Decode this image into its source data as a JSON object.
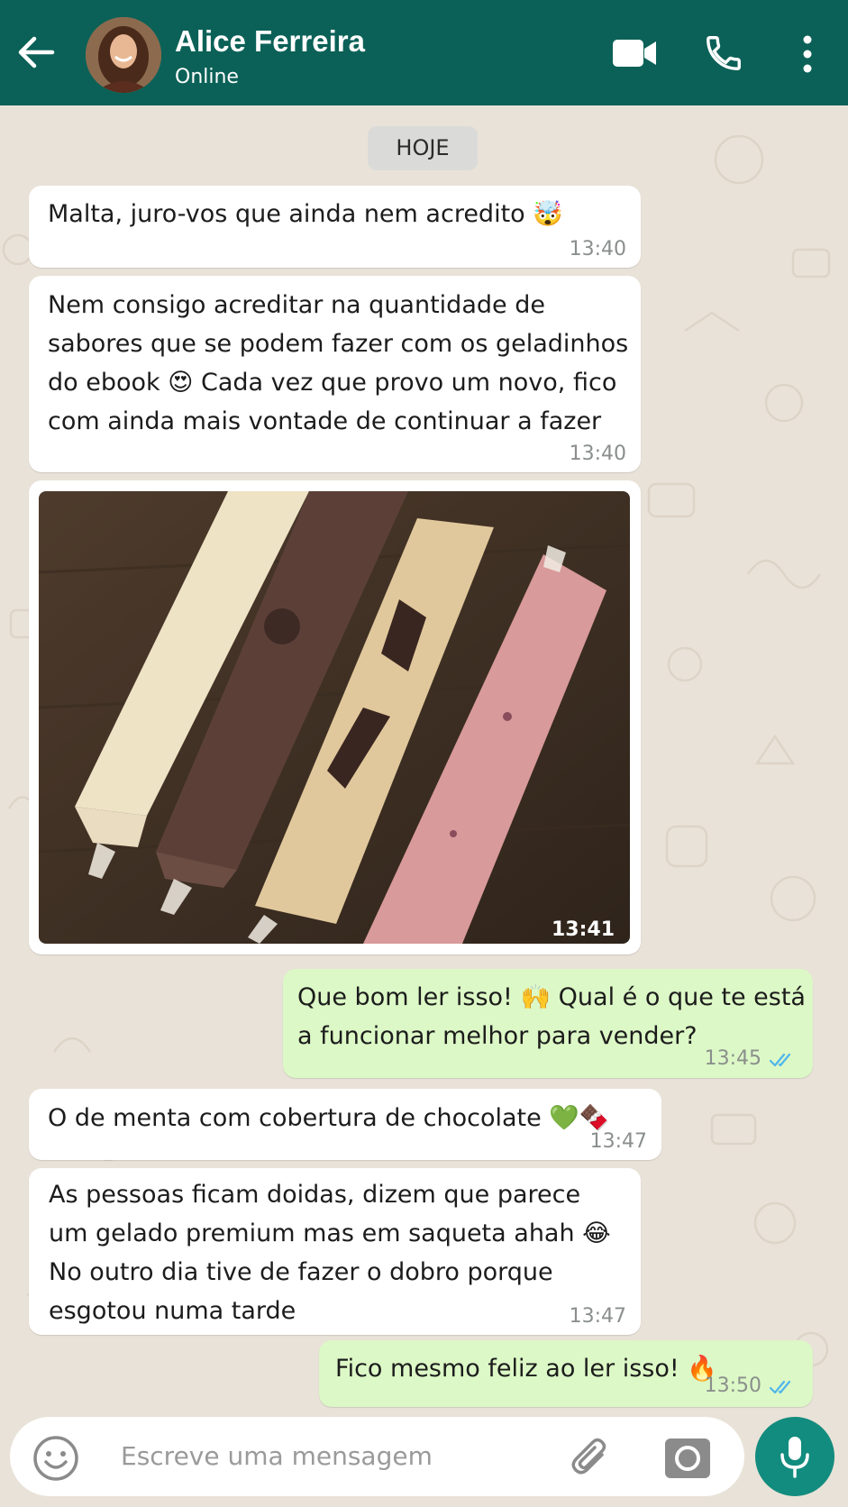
{
  "header": {
    "contact_name": "Alice Ferreira",
    "status": "Online",
    "icons": [
      "back-arrow-icon",
      "video-call-icon",
      "phone-icon",
      "more-options-icon"
    ]
  },
  "chat": {
    "day_label": "HOJE",
    "messages": [
      {
        "direction": "in",
        "lines": [
          "Malta, juro-vos que ainda nem acredito 🤯"
        ],
        "time": "13:40"
      },
      {
        "direction": "in",
        "lines": [
          "Nem consigo acreditar na quantidade de",
          "sabores que se podem fazer com os geladinhos",
          "do ebook 😍 Cada vez que provo um novo, fico",
          "com ainda mais vontade de continuar a fazer"
        ],
        "time": "13:40"
      },
      {
        "direction": "in",
        "image": "four frozen geladinho ice pops in plastic bags on a wooden board",
        "time": "13:41"
      },
      {
        "direction": "out",
        "lines": [
          "Que bom ler isso! 🙌 Qual é o que te está",
          "a funcionar melhor para vender?"
        ],
        "time": "13:45",
        "read": true
      },
      {
        "direction": "in",
        "lines": [
          "O de menta com cobertura de chocolate 💚🍫"
        ],
        "time": "13:47"
      },
      {
        "direction": "in",
        "lines": [
          "As pessoas ficam doidas, dizem que parece",
          "um gelado premium mas em saqueta ahah 😂",
          "No outro dia tive de fazer o dobro porque",
          "esgotou numa tarde"
        ],
        "time": "13:47"
      },
      {
        "direction": "out",
        "lines": [
          "Fico mesmo feliz ao ler isso! 🔥"
        ],
        "time": "13:50",
        "read": true
      }
    ]
  },
  "composer": {
    "placeholder": "Escreve uma mensagem",
    "icons": [
      "emoji-icon",
      "attach-icon",
      "camera-icon",
      "mic-icon"
    ]
  },
  "colors": {
    "header": "#0b6157",
    "wallpaper": "#e9e2d8",
    "incoming": "#ffffff",
    "outgoing": "#dcf8c6",
    "read_ticks": "#4fb6ec",
    "mic_button": "#128c7e"
  }
}
